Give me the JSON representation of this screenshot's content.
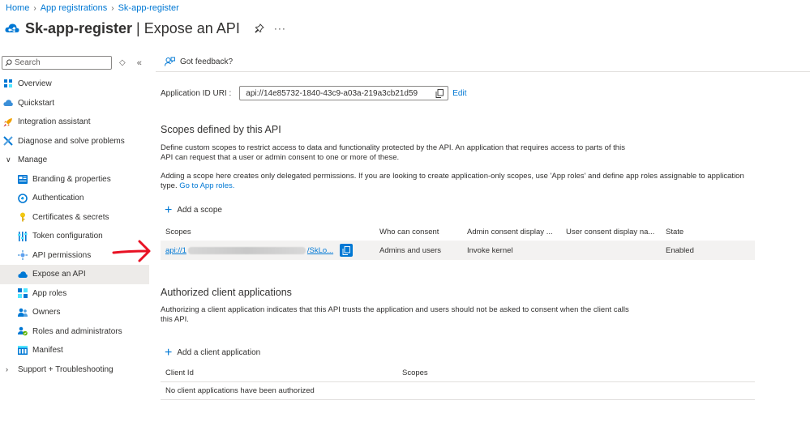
{
  "breadcrumb": {
    "home": "Home",
    "app_registrations": "App registrations",
    "current": "Sk-app-register"
  },
  "header": {
    "title": "Sk-app-register",
    "separator": "|",
    "subtitle": "Expose an API",
    "more": "···"
  },
  "sidebar": {
    "search_placeholder": "Search",
    "items": [
      {
        "label": "Overview",
        "icon": "overview-icon"
      },
      {
        "label": "Quickstart",
        "icon": "quickstart-icon"
      },
      {
        "label": "Integration assistant",
        "icon": "rocket-icon"
      },
      {
        "label": "Diagnose and solve problems",
        "icon": "wrench-icon"
      },
      {
        "label": "Manage",
        "icon": "chevron-down-icon"
      },
      {
        "label": "Branding & properties",
        "icon": "branding-icon"
      },
      {
        "label": "Authentication",
        "icon": "authentication-icon"
      },
      {
        "label": "Certificates & secrets",
        "icon": "key-icon"
      },
      {
        "label": "Token configuration",
        "icon": "token-icon"
      },
      {
        "label": "API permissions",
        "icon": "api-permissions-icon"
      },
      {
        "label": "Expose an API",
        "icon": "cloud-icon"
      },
      {
        "label": "App roles",
        "icon": "app-roles-icon"
      },
      {
        "label": "Owners",
        "icon": "owners-icon"
      },
      {
        "label": "Roles and administrators",
        "icon": "roles-icon"
      },
      {
        "label": "Manifest",
        "icon": "manifest-icon"
      },
      {
        "label": "Support + Troubleshooting",
        "icon": "chevron-right-icon"
      }
    ]
  },
  "feedback": {
    "label": "Got feedback?"
  },
  "app_id": {
    "label": "Application ID URI :",
    "value": "api://14e85732-1840-43c9-a03a-219a3cb21d59",
    "edit": "Edit"
  },
  "scopes": {
    "title": "Scopes defined by this API",
    "desc1": "Define custom scopes to restrict access to data and functionality protected by the API. An application that requires access to parts of this API can request that a user or admin consent to one or more of these.",
    "desc2": "Adding a scope here creates only delegated permissions. If you are looking to create application-only scopes, use 'App roles' and define app roles assignable to application type.",
    "desc2_link": "Go to App roles.",
    "add": "Add a scope",
    "columns": [
      "Scopes",
      "Who can consent",
      "Admin consent display ...",
      "User consent display na...",
      "State"
    ],
    "row": {
      "scope_start": "api://1",
      "scope_end": "/SkLo...",
      "who": "Admins and users",
      "admin_display": "Invoke kernel",
      "user_display": "",
      "state": "Enabled"
    }
  },
  "clients": {
    "title": "Authorized client applications",
    "desc": "Authorizing a client application indicates that this API trusts the application and users should not be asked to consent when the client calls this API.",
    "add": "Add a client application",
    "columns": [
      "Client Id",
      "Scopes"
    ],
    "empty": "No client applications have been authorized"
  },
  "colors": {
    "accent": "#0078d4",
    "arrow": "#e81123",
    "active_bg": "#edebe9"
  }
}
